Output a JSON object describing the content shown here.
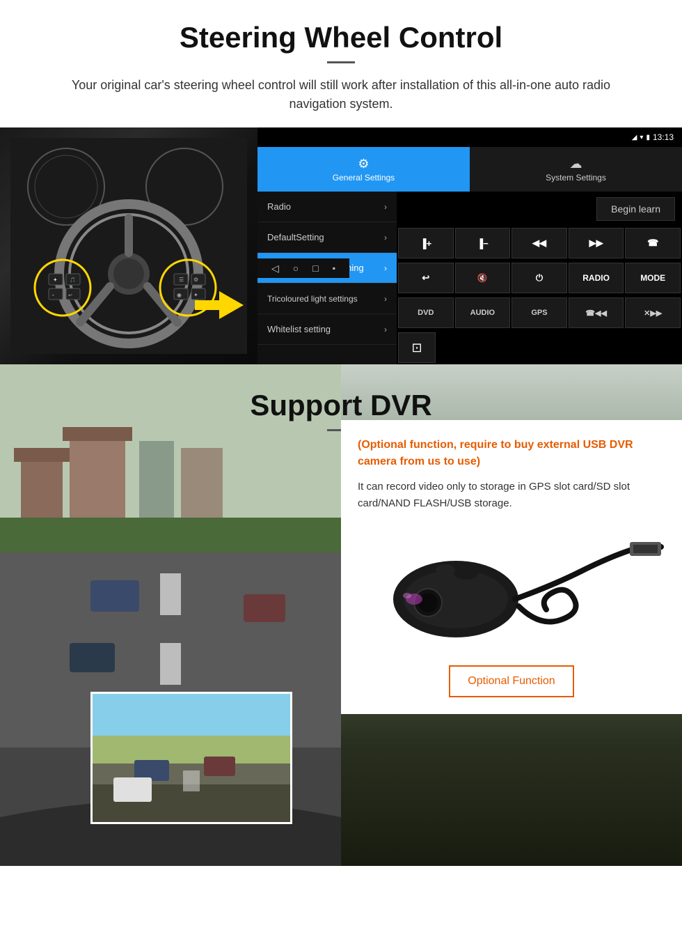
{
  "page": {
    "steering_section": {
      "title": "Steering Wheel Control",
      "subtitle": "Your original car's steering wheel control will still work after installation of this all-in-one auto radio navigation system.",
      "android_ui": {
        "statusbar": {
          "time": "13:13",
          "icons": [
            "signal",
            "wifi",
            "battery"
          ]
        },
        "nav_buttons": [
          "◁",
          "○",
          "□",
          "▪"
        ],
        "tabs": [
          {
            "id": "general",
            "label": "General Settings",
            "icon": "⚙",
            "active": true
          },
          {
            "id": "system",
            "label": "System Settings",
            "icon": "☁",
            "active": false
          }
        ],
        "menu_items": [
          {
            "label": "Radio",
            "active": false
          },
          {
            "label": "DefaultSetting",
            "active": false
          },
          {
            "label": "Steering Wheel learning",
            "active": true
          },
          {
            "label": "Tricoloured light settings",
            "active": false
          },
          {
            "label": "Whitelist setting",
            "active": false
          }
        ],
        "begin_learn_button": "Begin learn",
        "control_buttons_row1": [
          "▐+",
          "▐-",
          "◀◀",
          "▶▶",
          "☎"
        ],
        "control_buttons_row2": [
          "↩",
          "✕",
          "⏻",
          "RADIO",
          "MODE"
        ],
        "control_buttons_row3": [
          "DVD",
          "AUDIO",
          "GPS",
          "☎◀◀",
          "✕▶▶"
        ],
        "control_buttons_row4": [
          "⊡"
        ]
      }
    },
    "dvr_section": {
      "title": "Support DVR",
      "info_card": {
        "title": "(Optional function, require to buy external USB DVR camera from us to use)",
        "description": "It can record video only to storage in GPS slot card/SD slot card/NAND FLASH/USB storage.",
        "optional_button": "Optional Function"
      }
    }
  }
}
